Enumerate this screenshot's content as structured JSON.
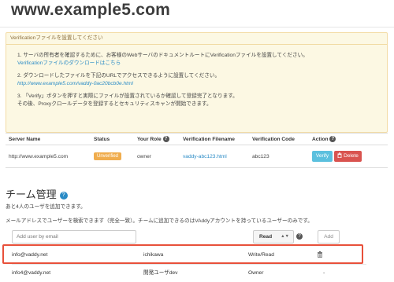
{
  "site": {
    "title": "www.example5.com"
  },
  "notice": {
    "heading": "Verificationファイルを設置してください",
    "step1_text": "1. サーバの所有者を確認するために、お客様のWebサーバのドキュメントルートにVerificationファイルを設置してください。",
    "step1_link": "Verificationファイルのダウンロードはこちら",
    "step2_text": "2. ダウンロードしたファイルを下記のURLでアクセスできるように設置してください。",
    "step2_link": "http://www.example5.com/vaddy-0ac20bcb0e.html",
    "step3_line1": "3. 「Verify」ボタンを押すと実際にファイルが設置されているか確認して登録完了となります。",
    "step3_line2": "その後、Proxyクロールデータを登録するとセキュリティスキャンが開始できます。"
  },
  "server_table": {
    "headers": {
      "server_name": "Server Name",
      "status": "Status",
      "your_role": "Your Role",
      "verification_filename": "Verification Filename",
      "verification_code": "Verification Code",
      "action": "Action"
    },
    "row": {
      "server_name": "http://www.example5.com",
      "status": "Unverified",
      "role": "owner",
      "filename": "vaddy-abc123.html",
      "code": "abc123",
      "verify_label": "Verify",
      "delete_label": "Delete"
    }
  },
  "team": {
    "title": "チーム管理",
    "remaining": "あと4人のユーザを追加できます。",
    "hint": "メールアドレスでユーザーを検索できます（完全一致）。チームに追加できるのはVAddyアカウントを持っているユーザーのみです。",
    "add_placeholder": "Add user by email",
    "role_selected": "Read",
    "add_button": "Add",
    "members": [
      {
        "email": "info@vaddy.net",
        "name": "ichikawa",
        "role": "Write/Read",
        "action": "delete"
      },
      {
        "email": "info4@vaddy.net",
        "name": "開発ユーザdev",
        "role": "Owner",
        "action": "-"
      }
    ]
  },
  "icons": {
    "help": "question-circle-icon",
    "trash": "trash-icon"
  },
  "colors": {
    "link": "#2a8bc6",
    "unverified_badge": "#f0ad4e",
    "verify_button": "#5bc0de",
    "delete_button": "#d9534f",
    "highlight": "#e8503a"
  }
}
